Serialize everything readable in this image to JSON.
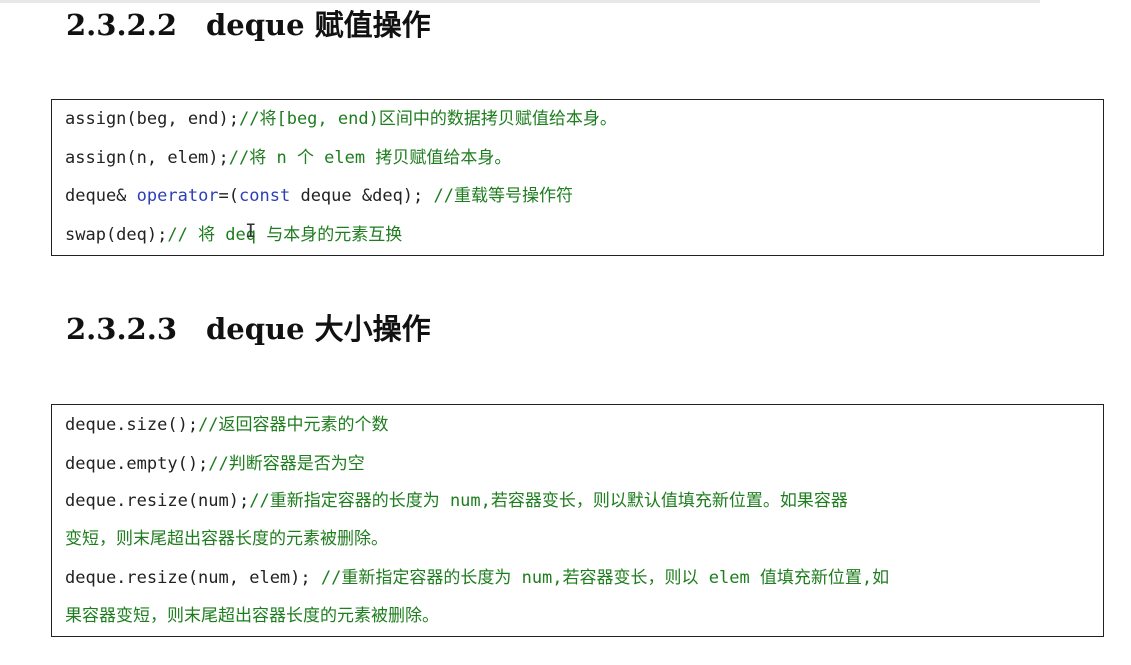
{
  "sections": [
    {
      "number": "2.3.2.2",
      "title": "deque 赋值操作",
      "lines": [
        {
          "code": "assign(beg, end);",
          "comment": "//将[beg, end)区间中的数据拷贝赋值给本身。"
        },
        {
          "code": "assign(n, elem);",
          "comment": "//将 n 个 elem 拷贝赋值给本身。"
        },
        {
          "code_pre": "deque& ",
          "keyword1": "operator",
          "code_mid": "=(",
          "keyword2": "const",
          "code_post": " deque &deq); ",
          "comment": "//重载等号操作符"
        },
        {
          "code": "swap(deq);",
          "comment": "// 将 deq 与本身的元素互换"
        }
      ]
    },
    {
      "number": "2.3.2.3",
      "title": "deque 大小操作",
      "lines": [
        {
          "code": "deque.size();",
          "comment": "//返回容器中元素的个数"
        },
        {
          "code": "deque.empty();",
          "comment": "//判断容器是否为空"
        },
        {
          "code": "deque.resize(num);",
          "comment": "//重新指定容器的长度为 num,若容器变长，则以默认值填充新位置。如果容器",
          "continuation": "变短，则末尾超出容器长度的元素被删除。"
        },
        {
          "code": "deque.resize(num, elem); ",
          "comment": "//重新指定容器的长度为 num,若容器变长，则以 elem 值填充新位置,如",
          "continuation": "果容器变短，则末尾超出容器长度的元素被删除。"
        }
      ]
    }
  ],
  "colors": {
    "comment": "#1e7d1e",
    "keyword": "#2d3fb5",
    "code": "#222222",
    "border": "#222222"
  }
}
